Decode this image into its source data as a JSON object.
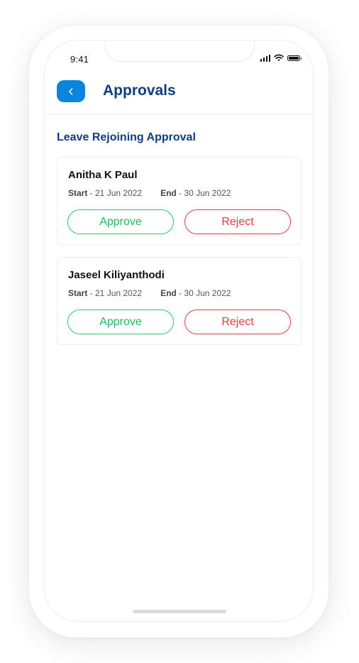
{
  "status_bar": {
    "time": "9:41"
  },
  "header": {
    "title": "Approvals"
  },
  "section": {
    "title": "Leave Rejoining Approval"
  },
  "cards": [
    {
      "name": "Anitha K Paul",
      "start_label": "Start",
      "start_value": " - 21 Jun  2022",
      "end_label": "End",
      "end_value": " - 30 Jun 2022",
      "approve_label": "Approve",
      "reject_label": "Reject"
    },
    {
      "name": "Jaseel Kiliyanthodi",
      "start_label": "Start",
      "start_value": " - 21 Jun  2022",
      "end_label": "End",
      "end_value": " - 30 Jun 2022",
      "approve_label": "Approve",
      "reject_label": "Reject"
    }
  ],
  "colors": {
    "primary": "#0b84de",
    "title": "#0d3f80",
    "approve": "#22b85f",
    "reject": "#e5393d"
  },
  "icons": {
    "back": "chevron-left-icon",
    "signal": "cellular-signal-icon",
    "wifi": "wifi-icon",
    "battery": "battery-icon"
  }
}
